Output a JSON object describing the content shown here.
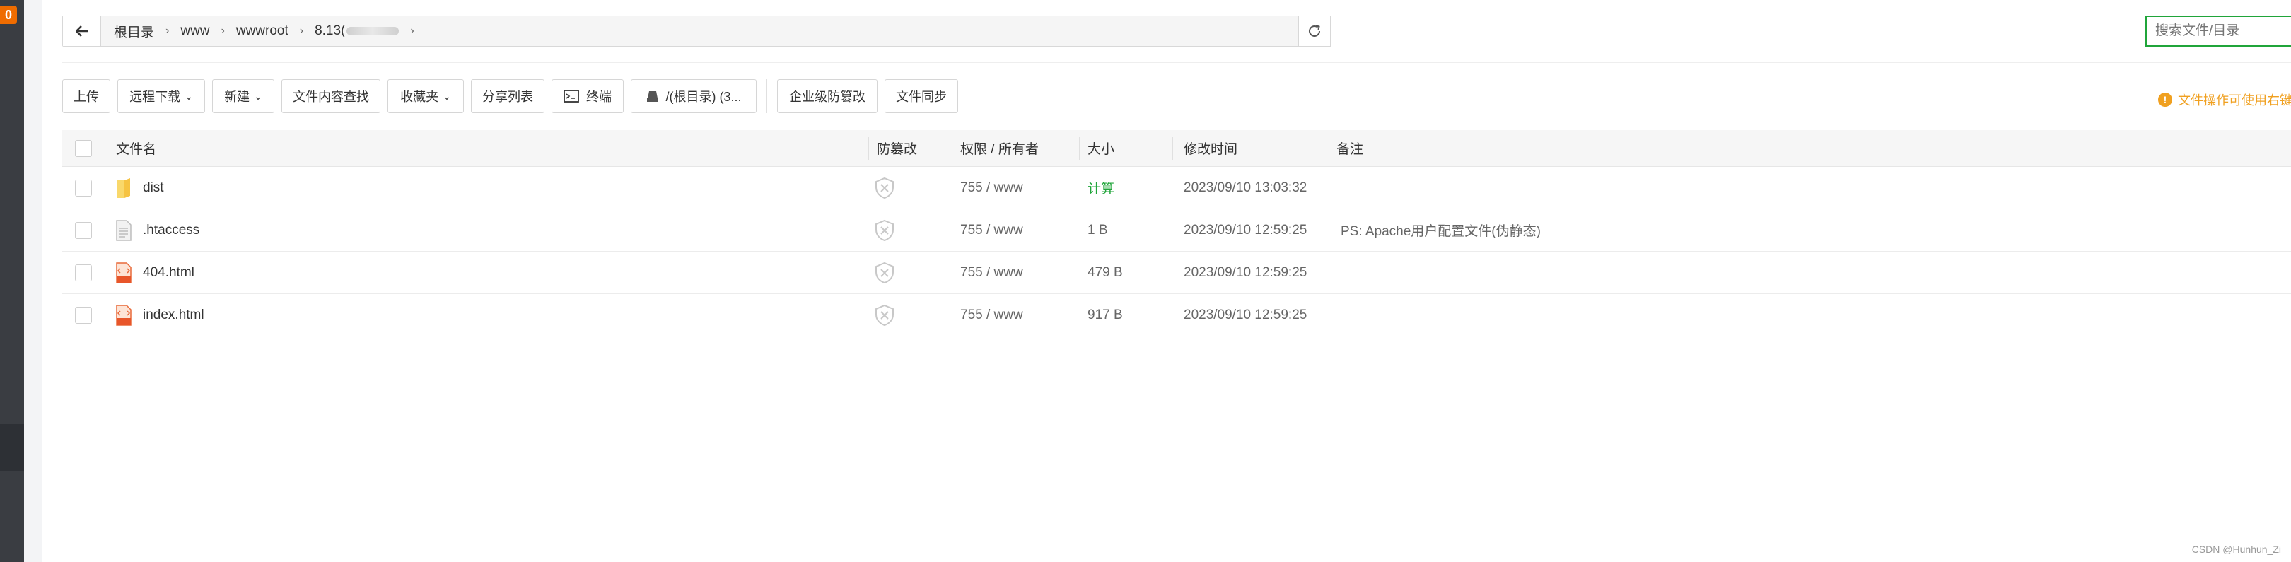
{
  "sidebar": {
    "badge": "0"
  },
  "pathbar": {
    "crumbs": [
      "根目录",
      "www",
      "wwwroot",
      "8.13("
    ]
  },
  "search": {
    "placeholder": "搜索文件/目录"
  },
  "toolbar": {
    "upload": "上传",
    "remote_download": "远程下载",
    "new": "新建",
    "content_search": "文件内容查找",
    "favorites": "收藏夹",
    "share_list": "分享列表",
    "terminal": "终端",
    "disk": "/(根目录) (3...",
    "enterprise_protect": "企业级防篡改",
    "file_sync": "文件同步"
  },
  "tip": {
    "text": "文件操作可使用右键"
  },
  "table": {
    "headers": {
      "name": "文件名",
      "protect": "防篡改",
      "perm": "权限 / 所有者",
      "size": "大小",
      "mtime": "修改时间",
      "note": "备注"
    },
    "rows": [
      {
        "name": "dist",
        "icon": "folder-icon",
        "perm": "755 / www",
        "size": "计算",
        "mtime": "2023/09/10 13:03:32",
        "note": ""
      },
      {
        "name": ".htaccess",
        "icon": "text-file-icon",
        "perm": "755 / www",
        "size": "1 B",
        "mtime": "2023/09/10 12:59:25",
        "note": "PS: Apache用户配置文件(伪静态)"
      },
      {
        "name": "404.html",
        "icon": "html-file-icon",
        "perm": "755 / www",
        "size": "479 B",
        "mtime": "2023/09/10 12:59:25",
        "note": ""
      },
      {
        "name": "index.html",
        "icon": "html-file-icon",
        "perm": "755 / www",
        "size": "917 B",
        "mtime": "2023/09/10 12:59:25",
        "note": ""
      }
    ]
  },
  "colors": {
    "accent": "#20a53a",
    "warning": "#f0a020",
    "sidebar": "#3a3d42"
  },
  "watermark": "CSDN @Hunhun_Zi"
}
